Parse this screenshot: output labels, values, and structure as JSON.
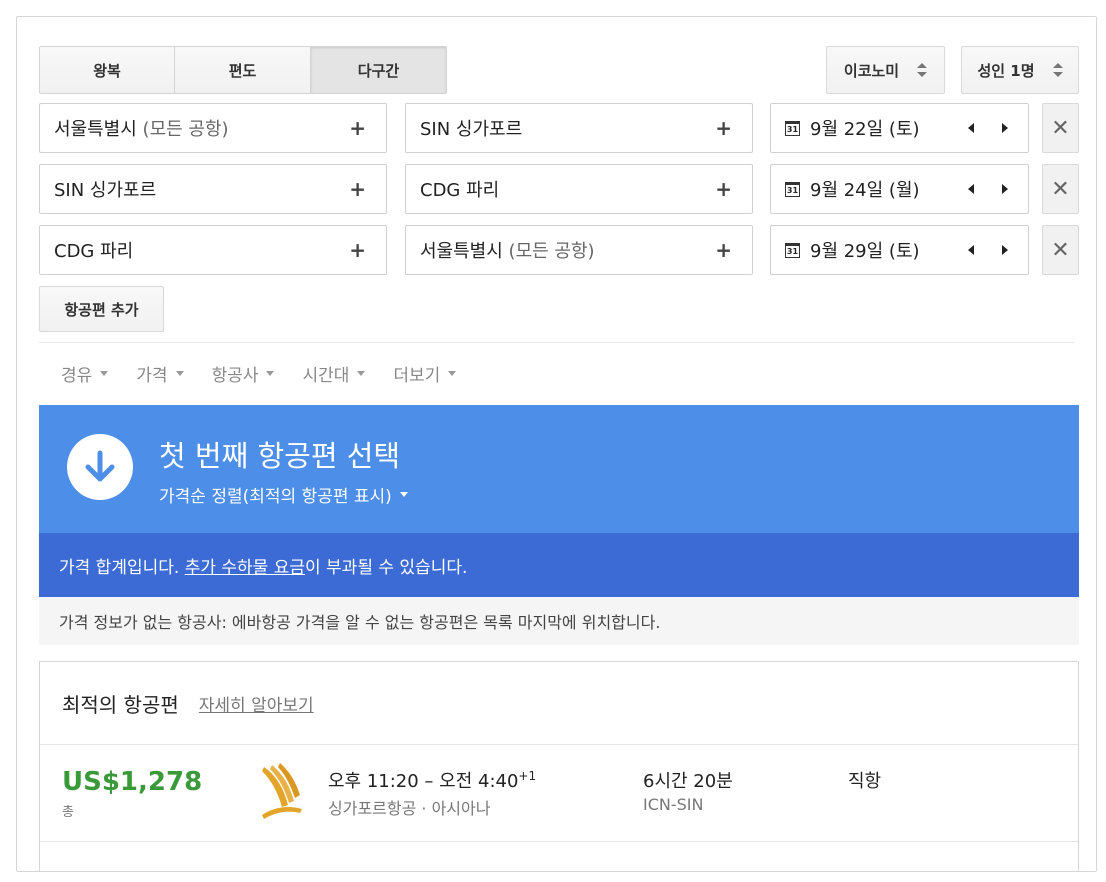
{
  "trip_type": {
    "round_trip": "왕복",
    "one_way": "편도",
    "multi_city": "다구간"
  },
  "cabin_class": "이코노미",
  "passengers": "성인 1명",
  "legs": [
    {
      "origin": "서울특별시",
      "origin_muted": "(모든 공항)",
      "destination": "SIN 싱가포르",
      "destination_muted": "",
      "date": "9월 22일 (토)"
    },
    {
      "origin": "SIN 싱가포르",
      "origin_muted": "",
      "destination": "CDG 파리",
      "destination_muted": "",
      "date": "9월 24일 (월)"
    },
    {
      "origin": "CDG 파리",
      "origin_muted": "",
      "destination": "서울특별시",
      "destination_muted": "(모든 공항)",
      "date": "9월 29일 (토)"
    }
  ],
  "calendar_icon_text": "31",
  "plus_symbol": "+",
  "remove_symbol": "✕",
  "add_flight_label": "항공편 추가",
  "filters": [
    "경유",
    "가격",
    "항공사",
    "시간대",
    "더보기"
  ],
  "banner": {
    "title": "첫 번째 항공편 선택",
    "sort_label": "가격순 정렬(최적의 항공편 표시)"
  },
  "notice": {
    "prefix": "가격 합계입니다. ",
    "link": "추가 수하물 요금",
    "suffix": "이 부과될 수 있습니다."
  },
  "info_text": "가격 정보가 없는 항공사: 에바항공 가격을 알 수 없는 항공편은 목록 마지막에 위치합니다.",
  "results": {
    "heading": "최적의 항공편",
    "learn_more": "자세히 알아보기",
    "flights": [
      {
        "price": "US$1,278",
        "price_note": "총",
        "times": "오후 11:20 – 오전 4:40",
        "day_offset": "+1",
        "airlines": "싱가포르항공 · 아시아나",
        "duration": "6시간 20분",
        "route": "ICN-SIN",
        "stops": "직항"
      }
    ]
  },
  "colors": {
    "banner_blue": "#4d8ee9",
    "notice_blue": "#3d6bd6",
    "price_green": "#3a9a3a",
    "logo_gold": "#e2a52a"
  }
}
